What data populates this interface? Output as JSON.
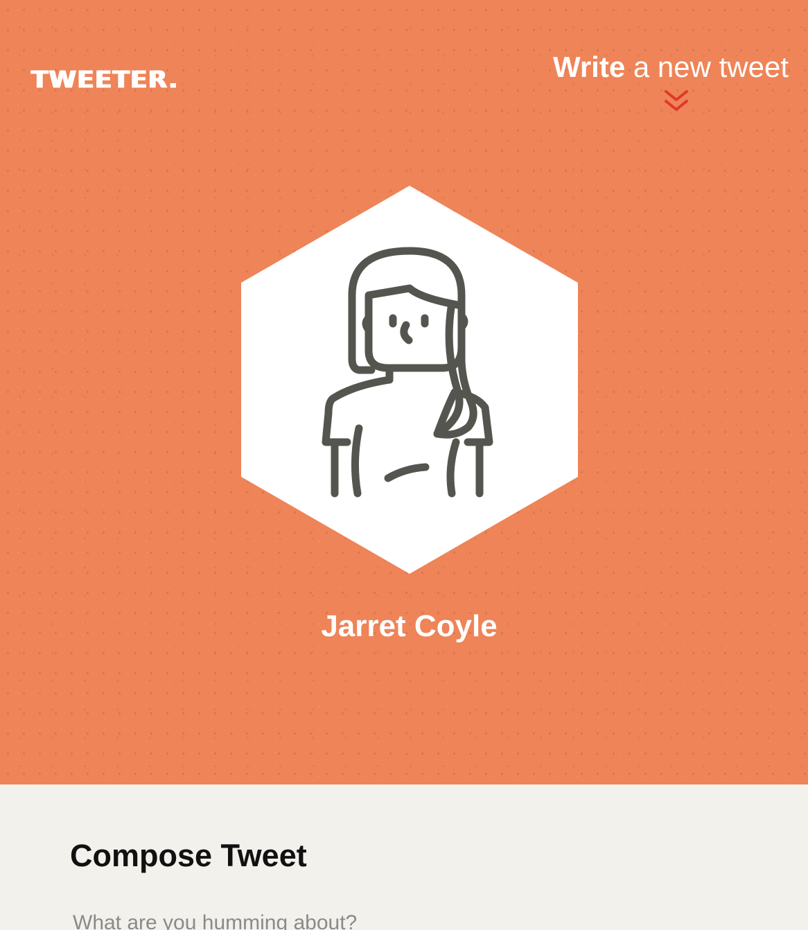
{
  "header": {
    "logo_text": "TWEETER.",
    "write_link": {
      "strong": "Write",
      "rest": "a new tweet",
      "icon": "double-chevron-down-icon"
    }
  },
  "profile": {
    "name": "Jarret Coyle",
    "avatar_icon": "user-avatar-icon"
  },
  "compose": {
    "title": "Compose Tweet",
    "placeholder": "What are you humming about?",
    "value": ""
  },
  "colors": {
    "hero_background": "#ee8458",
    "accent_chevron": "#e0382a",
    "avatar_stroke": "#555550",
    "compose_background": "#f3f1ec"
  }
}
